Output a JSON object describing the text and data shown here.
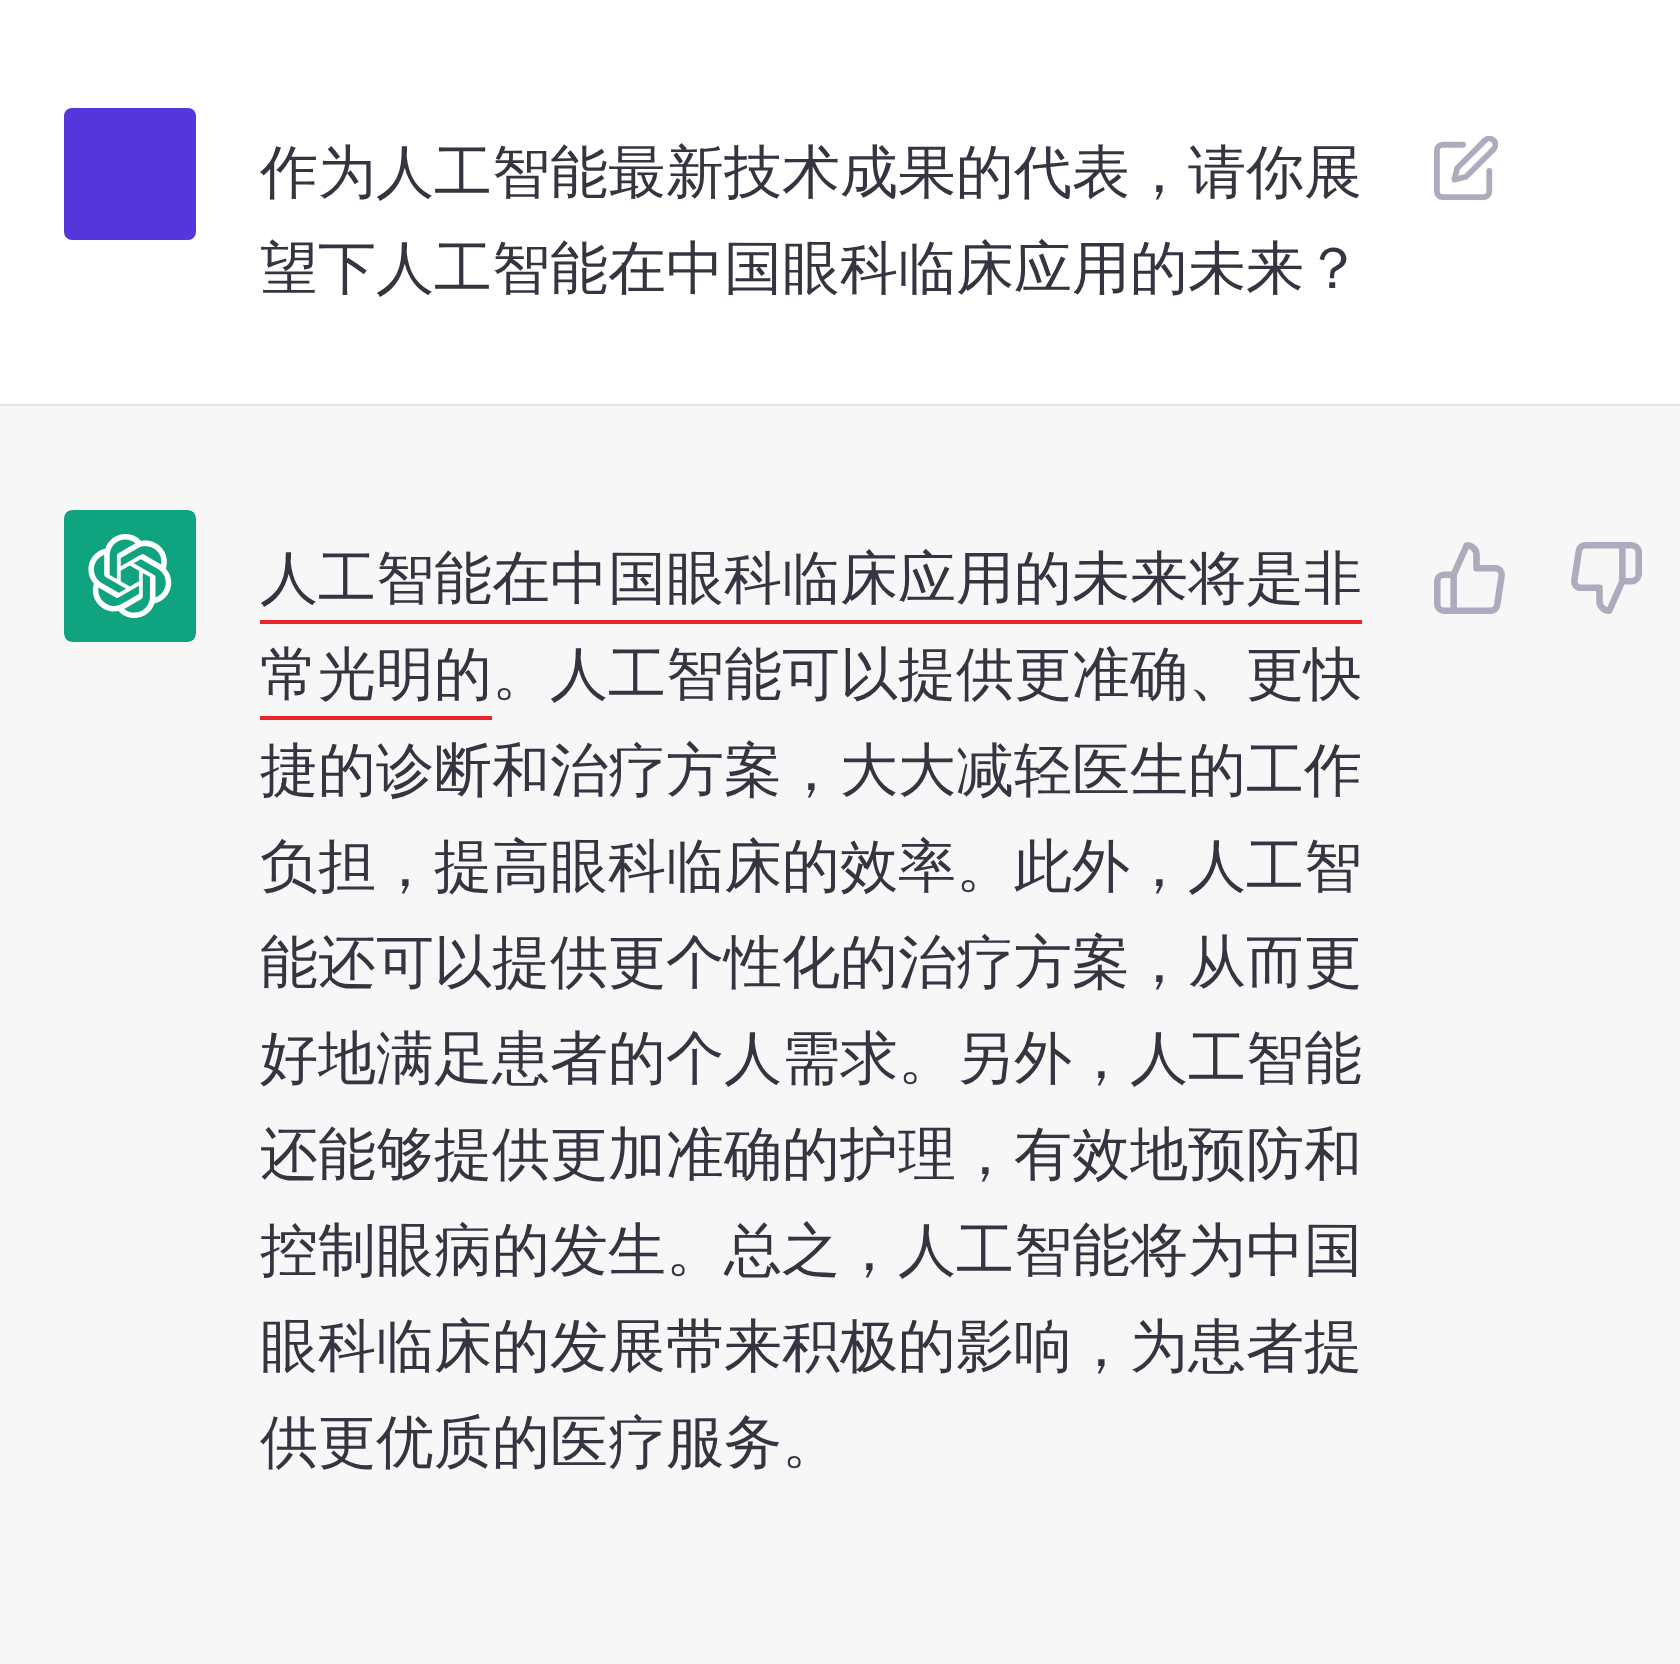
{
  "messages": [
    {
      "kind": "user",
      "text": "作为人工智能最新技术成果的代表，请你展望下人工智能在中国眼科临床应用的未来？"
    },
    {
      "kind": "assistant",
      "segments": [
        {
          "text": "人工智能在中国眼科临床应用的未来将是非常光明的",
          "underlined": true
        },
        {
          "text": "。人工智能可以提供更准确、更快捷的诊断和治疗方案，大大减轻医生的工作负担，提高眼科临床的效率。此外，人工智能还可以提供更个性化的治疗方案，从而更好地满足患者的个人需求。另外，人工智能还能够提供更加准确的护理，有效地预防和控制眼病的发生。总之，人工智能将为中国眼科临床的发展带来积极的影响，为患者提供更优质的医疗服务。",
          "underlined": false
        }
      ]
    }
  ]
}
